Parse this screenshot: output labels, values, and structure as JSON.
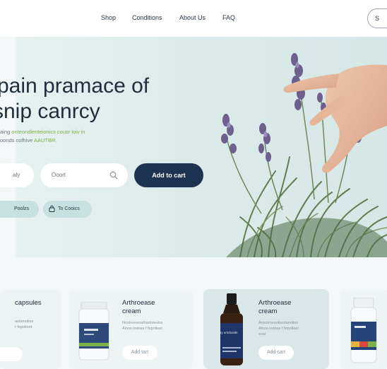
{
  "nav": {
    "items": [
      "Shop",
      "Conditions",
      "About Us",
      "FAQ"
    ],
    "signin_label": "S"
  },
  "hero": {
    "headline_line1": "pain pramace of",
    "headline_line2": "snip canrcy",
    "subtext_line1_a": "aing",
    "subtext_line1_b": "onteondlenteionics cousr loiv in",
    "subtext_line2_a": "oonds cofhive",
    "subtext_line2_b": "AAUTBR.",
    "daily_label": "aly",
    "search_placeholder": "Ooort",
    "add_to_cart_label": "Add to cart",
    "chip1_label": "Poolzs",
    "chip2_label": "To Cooics"
  },
  "products": [
    {
      "title": "capsules",
      "desc_line1": "aolemolios",
      "desc_line2": "r fepolleet",
      "button": ""
    },
    {
      "title_line1": "Arthroease",
      "title_line2": "cream",
      "desc_line1": "Nostnoceoalhadomolos",
      "desc_line2": "Aloos lodoas f fepolleet",
      "button": "Add tart"
    },
    {
      "title_line1": "Arthroease",
      "title_line2": "cream",
      "desc_line1": "Aosoirneaollssdamilios",
      "desc_line2": "Aloos lodoas f fepolleet",
      "desc_line3": "sool",
      "button": "Add cart",
      "bottle_label": "Ny urndoxide"
    }
  ],
  "colors": {
    "primary": "#1c3352",
    "accent_green": "#7bb247",
    "hero_bg": "#dcebea",
    "chip_bg": "#c7e0e0",
    "card_bg": "#eef3f4"
  }
}
